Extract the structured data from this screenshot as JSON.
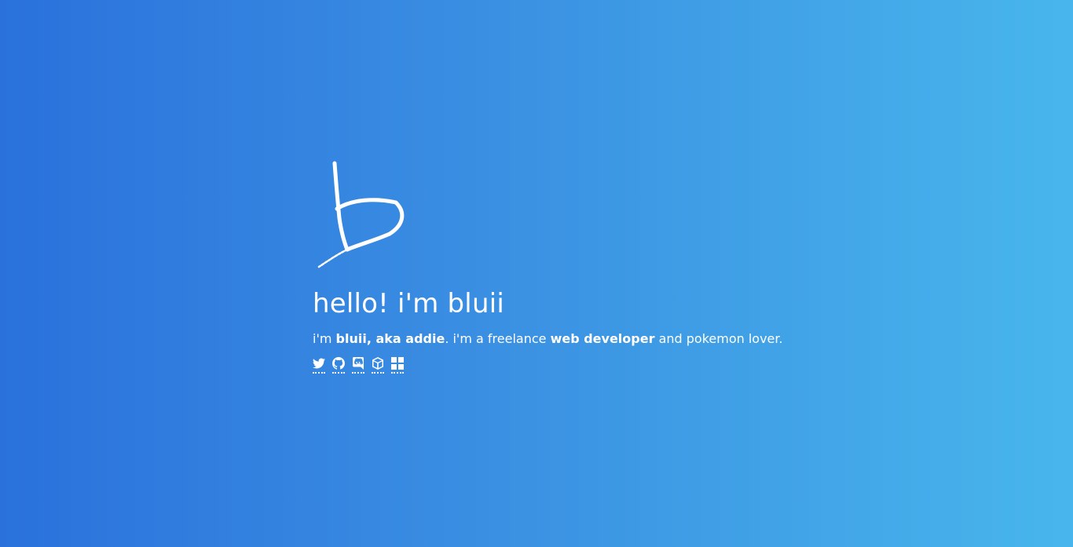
{
  "page": {
    "logo_icon": "handwritten-b-logo",
    "title": "hello! i'm bluii"
  },
  "bio": {
    "part1": "i'm ",
    "name": "bluii, aka addie",
    "part2": ". i'm a freelance ",
    "role": "web developer",
    "part3": " and pokemon lover."
  },
  "social_links": [
    {
      "icon": "twitter-icon"
    },
    {
      "icon": "github-icon"
    },
    {
      "icon": "discord-icon"
    },
    {
      "icon": "cube-icon"
    },
    {
      "icon": "grid-icon"
    }
  ],
  "colors": {
    "gradient_start": "#2a71dc",
    "gradient_end": "#48b6ec",
    "text": "#ffffff"
  }
}
